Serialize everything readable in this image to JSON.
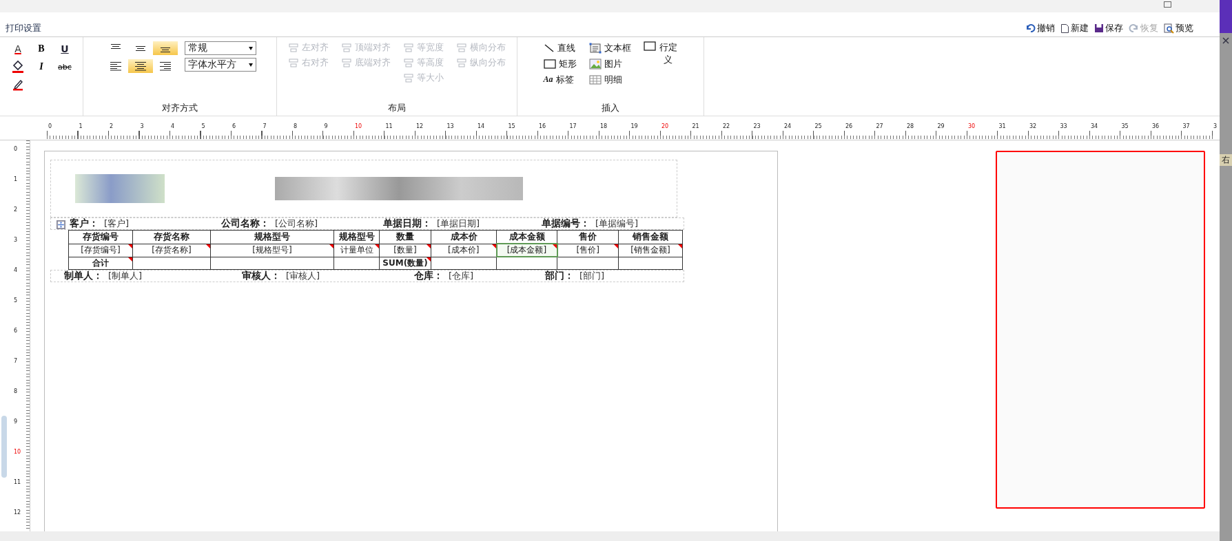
{
  "window": {
    "title": "打印设置"
  },
  "actions": [
    {
      "kind": "undo",
      "label": "撤销",
      "disabled": false
    },
    {
      "kind": "new",
      "label": "新建",
      "disabled": false
    },
    {
      "kind": "save",
      "label": "保存",
      "disabled": false
    },
    {
      "kind": "redo",
      "label": "恢复",
      "disabled": true
    },
    {
      "kind": "preview",
      "label": "预览",
      "disabled": false
    }
  ],
  "font_group": {
    "buttons": [
      {
        "kind": "font-color",
        "glyph": "A"
      },
      {
        "kind": "bold",
        "glyph": "B"
      },
      {
        "kind": "underline",
        "glyph": "U"
      },
      {
        "kind": "fill"
      },
      {
        "kind": "italic",
        "glyph": "I"
      },
      {
        "kind": "strike",
        "glyph": "abc"
      },
      {
        "kind": "pen"
      }
    ]
  },
  "align_group": {
    "label": "对齐方式",
    "buttons": [
      {
        "kind": "top",
        "selected": false
      },
      {
        "kind": "middle",
        "selected": false
      },
      {
        "kind": "bottom",
        "selected": true
      },
      {
        "kind": "left",
        "selected": false
      },
      {
        "kind": "center",
        "selected": true
      },
      {
        "kind": "right",
        "selected": false
      }
    ],
    "dropdowns": [
      {
        "value": "常规"
      },
      {
        "value": "字体水平方"
      }
    ]
  },
  "layout_group": {
    "label": "布局",
    "columns": [
      [
        {
          "label": "左对齐",
          "disabled": true
        },
        {
          "label": "右对齐",
          "disabled": true
        }
      ],
      [
        {
          "label": "顶端对齐",
          "disabled": true
        },
        {
          "label": "底端对齐",
          "disabled": true
        }
      ],
      [
        {
          "label": "等宽度",
          "disabled": true
        },
        {
          "label": "等高度",
          "disabled": true
        },
        {
          "label": "等大小",
          "disabled": true
        }
      ],
      [
        {
          "label": "横向分布",
          "disabled": true
        },
        {
          "label": "纵向分布",
          "disabled": true
        }
      ]
    ]
  },
  "insert_group": {
    "label": "插入",
    "columns": [
      [
        {
          "kind": "line",
          "label": "直线"
        },
        {
          "kind": "rect",
          "label": "矩形"
        },
        {
          "kind": "label",
          "label": "标签",
          "glyph": "Aa"
        }
      ],
      [
        {
          "kind": "textbox",
          "label": "文本框"
        },
        {
          "kind": "picture",
          "label": "图片"
        },
        {
          "kind": "detail",
          "label": "明细"
        }
      ],
      [
        {
          "kind": "rowdef",
          "label": "行定义"
        }
      ]
    ]
  },
  "ruler": {
    "horizontal": [
      {
        "label": "0",
        "highlight": false
      },
      {
        "label": "1",
        "highlight": false
      },
      {
        "label": "2",
        "highlight": false
      },
      {
        "label": "3",
        "highlight": false
      },
      {
        "label": "4",
        "highlight": false
      },
      {
        "label": "5",
        "highlight": false
      },
      {
        "label": "6",
        "highlight": false
      },
      {
        "label": "7",
        "highlight": false
      },
      {
        "label": "8",
        "highlight": false
      },
      {
        "label": "9",
        "highlight": false
      },
      {
        "label": "10",
        "highlight": true
      },
      {
        "label": "11",
        "highlight": false
      },
      {
        "label": "12",
        "highlight": false
      },
      {
        "label": "13",
        "highlight": false
      },
      {
        "label": "14",
        "highlight": false
      },
      {
        "label": "15",
        "highlight": false
      },
      {
        "label": "16",
        "highlight": false
      },
      {
        "label": "17",
        "highlight": false
      },
      {
        "label": "18",
        "highlight": false
      },
      {
        "label": "19",
        "highlight": false
      },
      {
        "label": "20",
        "highlight": true
      },
      {
        "label": "21",
        "highlight": false
      },
      {
        "label": "22",
        "highlight": false
      },
      {
        "label": "23",
        "highlight": false
      },
      {
        "label": "24",
        "highlight": false
      },
      {
        "label": "25",
        "highlight": false
      },
      {
        "label": "26",
        "highlight": false
      },
      {
        "label": "27",
        "highlight": false
      },
      {
        "label": "28",
        "highlight": false
      },
      {
        "label": "29",
        "highlight": false
      },
      {
        "label": "30",
        "highlight": true
      },
      {
        "label": "31",
        "highlight": false
      },
      {
        "label": "32",
        "highlight": false
      },
      {
        "label": "33",
        "highlight": false
      },
      {
        "label": "34",
        "highlight": false
      },
      {
        "label": "35",
        "highlight": false
      },
      {
        "label": "36",
        "highlight": false
      },
      {
        "label": "37",
        "highlight": false
      },
      {
        "label": "3",
        "highlight": false
      }
    ],
    "vertical": [
      {
        "label": "0",
        "highlight": false
      },
      {
        "label": "1",
        "highlight": false
      },
      {
        "label": "2",
        "highlight": false
      },
      {
        "label": "3",
        "highlight": false
      },
      {
        "label": "4",
        "highlight": false
      },
      {
        "label": "5",
        "highlight": false
      },
      {
        "label": "6",
        "highlight": false
      },
      {
        "label": "7",
        "highlight": false
      },
      {
        "label": "8",
        "highlight": false
      },
      {
        "label": "9",
        "highlight": false
      },
      {
        "label": "10",
        "highlight": true
      },
      {
        "label": "11",
        "highlight": false
      },
      {
        "label": "12",
        "highlight": false
      }
    ]
  },
  "report": {
    "header_fields": [
      {
        "label": "客户：",
        "value": "[客户]"
      },
      {
        "label": "公司名称：",
        "value": "[公司名称]"
      },
      {
        "label": "单据日期：",
        "value": "[单据日期]"
      },
      {
        "label": "单据编号：",
        "value": "[单据编号]"
      }
    ],
    "table": {
      "columns": [
        "存货编号",
        "存货名称",
        "规格型号",
        "规格型号",
        "数量",
        "成本价",
        "成本金额",
        "售价",
        "销售金额"
      ],
      "row": [
        {
          "text": "[存货编号]",
          "flag": true,
          "selected": false
        },
        {
          "text": "[存货名称]",
          "flag": true,
          "selected": false
        },
        {
          "text": "[规格型号]",
          "flag": true,
          "selected": false
        },
        {
          "text": "计量单位",
          "flag": true,
          "selected": false
        },
        {
          "text": "[数量]",
          "flag": true,
          "selected": false
        },
        {
          "text": "[成本价]",
          "flag": true,
          "selected": false
        },
        {
          "text": "[成本金额]",
          "flag": true,
          "selected": true
        },
        {
          "text": "[售价]",
          "flag": true,
          "selected": false
        },
        {
          "text": "[销售金额]",
          "flag": true,
          "selected": false
        }
      ],
      "total_row": [
        {
          "text": "合计",
          "flag": true
        },
        {
          "flag": false
        },
        {
          "flag": false
        },
        {
          "flag": false
        },
        {
          "text": "SUM(数量)",
          "flag": true
        },
        {
          "flag": false
        },
        {
          "flag": false
        },
        {
          "flag": false
        },
        {
          "flag": false
        }
      ]
    },
    "footer_fields": [
      {
        "label": "制单人：",
        "value": "[制单人]"
      },
      {
        "label": "审核人：",
        "value": "[审核人]"
      },
      {
        "label": "仓库：",
        "value": "[仓库]"
      },
      {
        "label": "部门：",
        "value": "[部门]"
      }
    ]
  },
  "side_panel": {
    "text": "右"
  }
}
